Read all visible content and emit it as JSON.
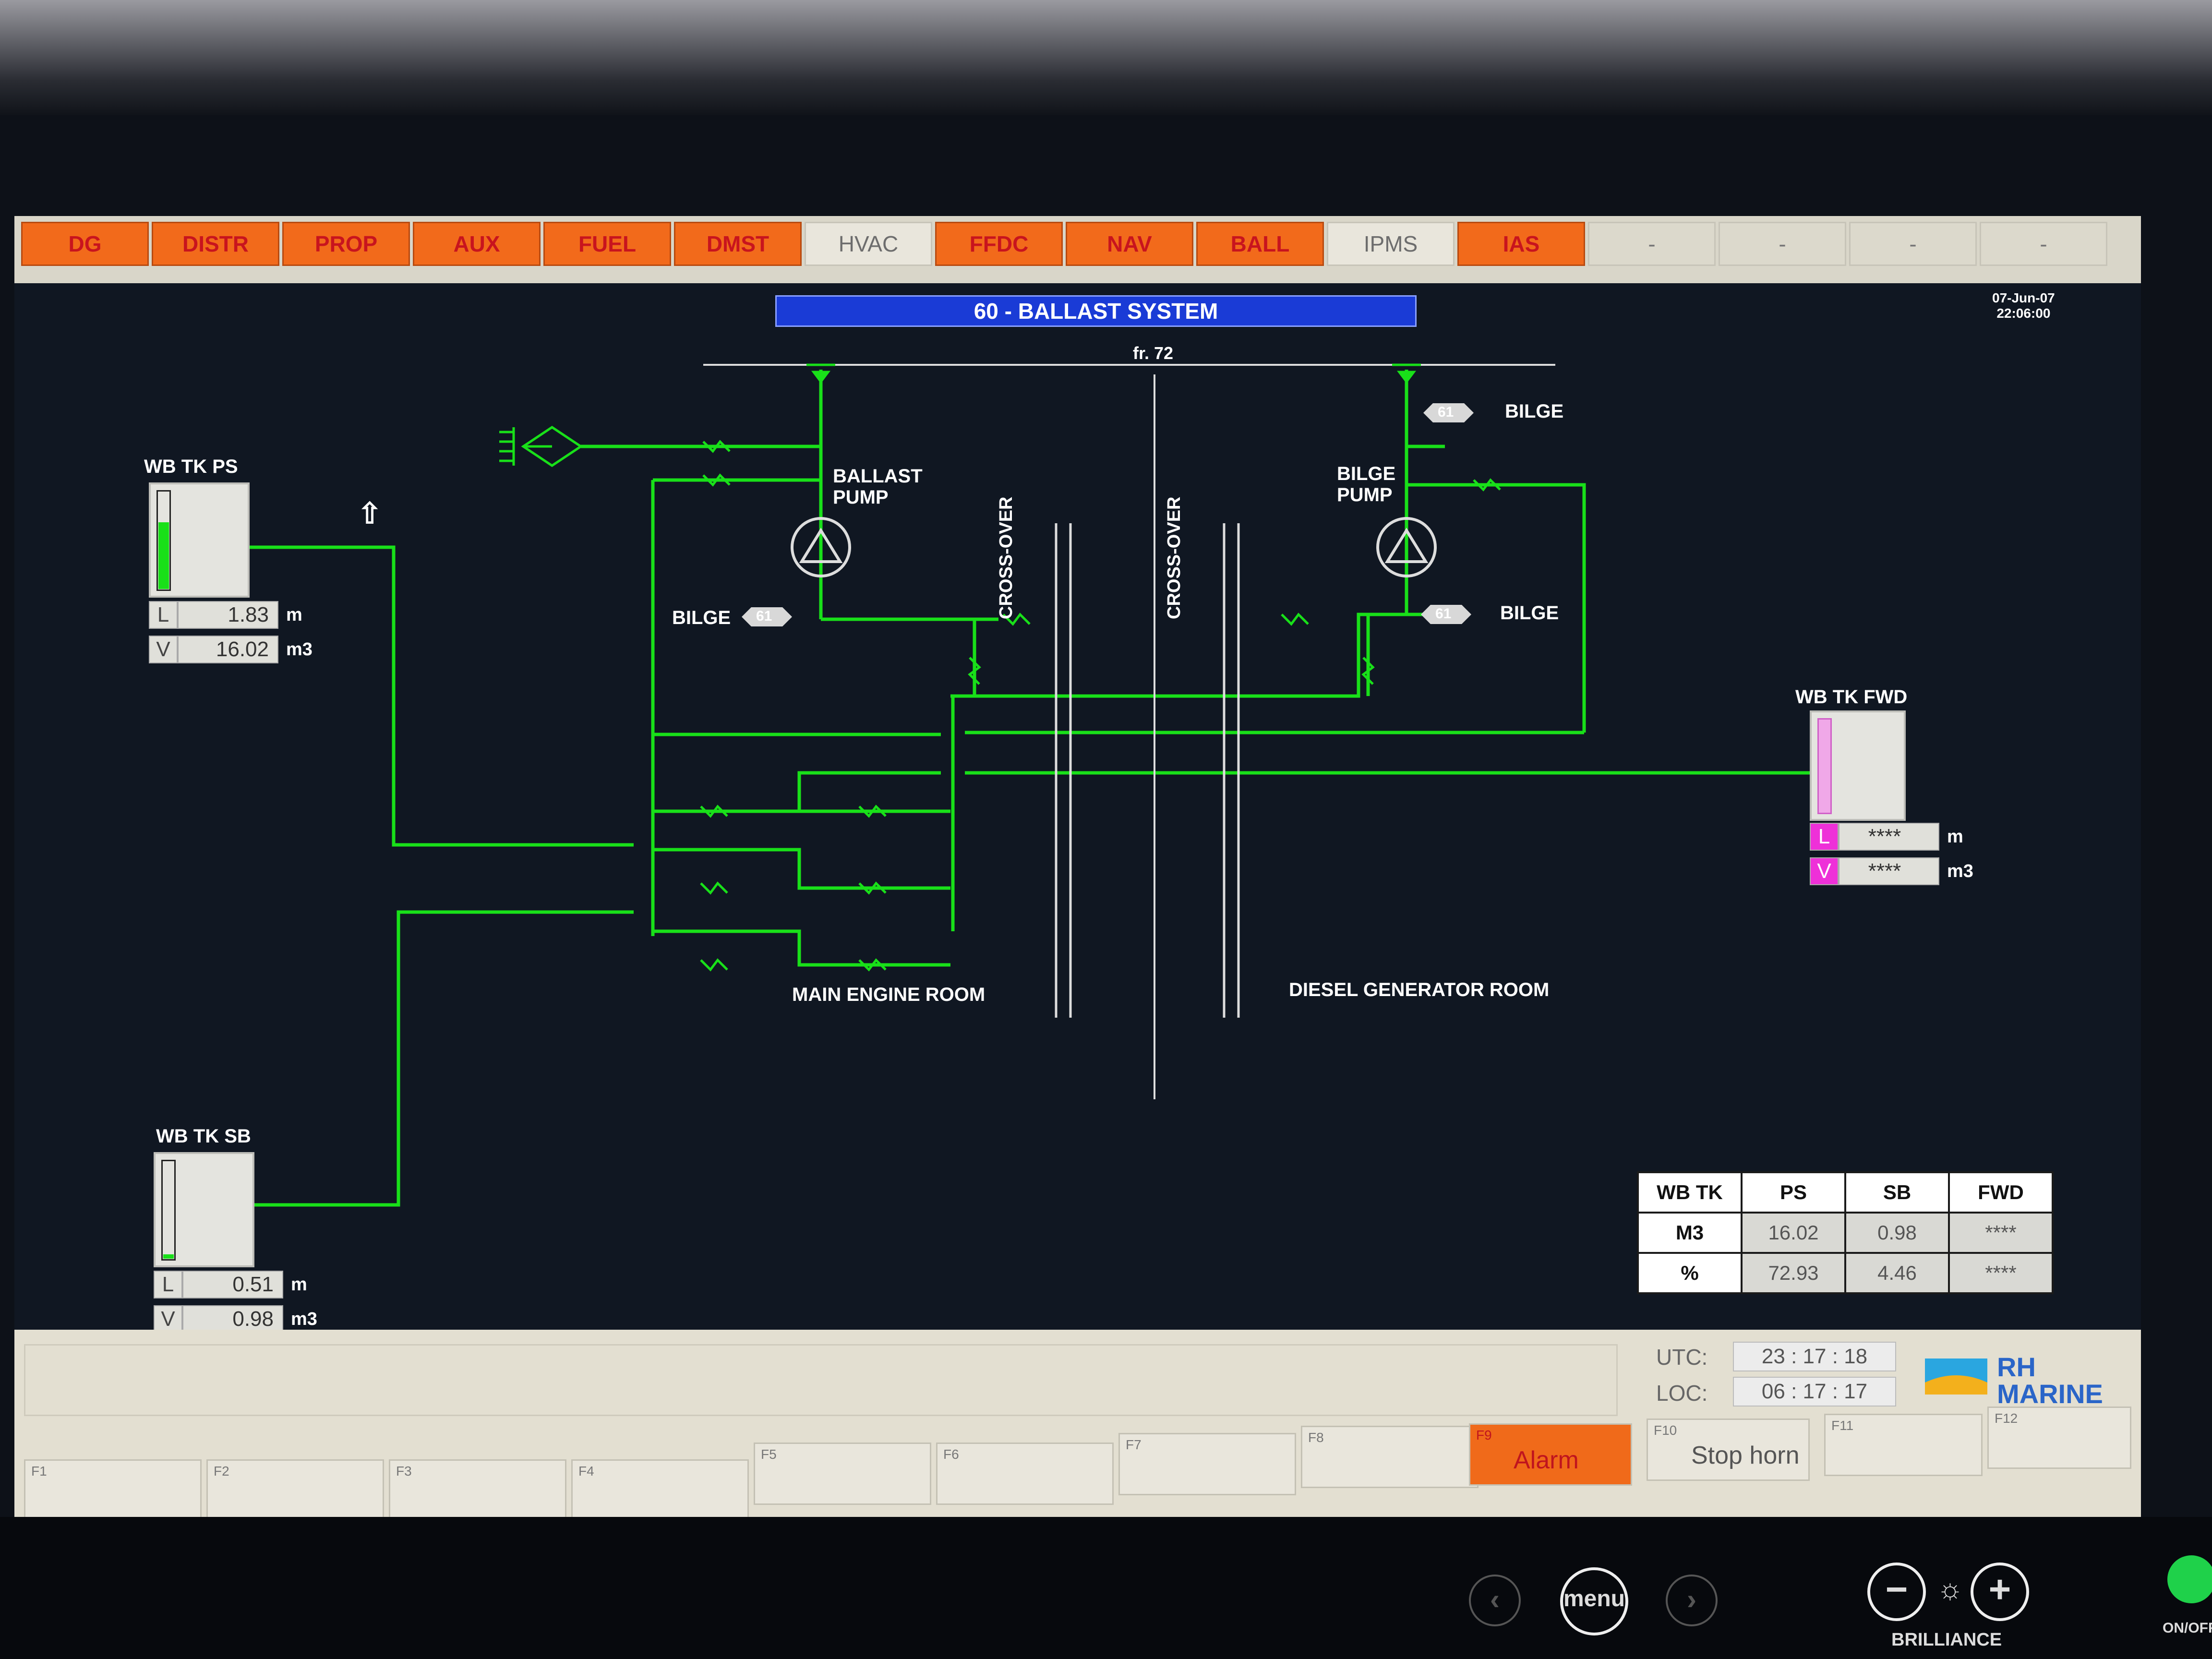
{
  "top_nav": [
    {
      "label": "DG",
      "state": "on"
    },
    {
      "label": "DISTR",
      "state": "on"
    },
    {
      "label": "PROP",
      "state": "on"
    },
    {
      "label": "AUX",
      "state": "on"
    },
    {
      "label": "FUEL",
      "state": "on"
    },
    {
      "label": "DMST",
      "state": "on"
    },
    {
      "label": "HVAC",
      "state": "off"
    },
    {
      "label": "FFDC",
      "state": "on"
    },
    {
      "label": "NAV",
      "state": "on"
    },
    {
      "label": "BALL",
      "state": "on"
    },
    {
      "label": "IPMS",
      "state": "off"
    },
    {
      "label": "IAS",
      "state": "on"
    },
    {
      "label": "-",
      "state": "blank"
    },
    {
      "label": "-",
      "state": "blank"
    },
    {
      "label": "-",
      "state": "blank"
    },
    {
      "label": "-",
      "state": "blank"
    }
  ],
  "title": "60 - BALLAST SYSTEM",
  "date": "07-Jun-07",
  "time": "22:06:00",
  "frame_label": "fr. 72",
  "labels": {
    "ballast_pump": "BALLAST\nPUMP",
    "bilge_pump": "BILGE\nPUMP",
    "bilge": "BILGE",
    "tag_61": "61",
    "crossover": "CROSS-OVER",
    "main_engine_room": "MAIN ENGINE ROOM",
    "dg_room": "DIESEL GENERATOR ROOM"
  },
  "tanks": {
    "ps": {
      "name": "WB TK PS",
      "L": "1.83",
      "V": "16.02",
      "L_unit": "m",
      "V_unit": "m3",
      "level": 0.73
    },
    "sb": {
      "name": "WB TK SB",
      "L": "0.51",
      "V": "0.98",
      "L_unit": "m",
      "V_unit": "m3",
      "level": 0.05
    },
    "fwd": {
      "name": "WB TK FWD",
      "L": "****",
      "V": "****",
      "L_unit": "m",
      "V_unit": "m3"
    }
  },
  "summary_table": {
    "headers": [
      "WB TK",
      "PS",
      "SB",
      "FWD"
    ],
    "rows": [
      {
        "label": "M3",
        "values": [
          "16.02",
          "0.98",
          "****"
        ]
      },
      {
        "label": "%",
        "values": [
          "72.93",
          "4.46",
          "****"
        ]
      }
    ]
  },
  "clock": {
    "utc_label": "UTC:",
    "utc": "23 : 17 : 18",
    "loc_label": "LOC:",
    "loc": "06 : 17 : 17"
  },
  "fkeys": [
    {
      "n": "F1",
      "t": ""
    },
    {
      "n": "F2",
      "t": ""
    },
    {
      "n": "F3",
      "t": ""
    },
    {
      "n": "F4",
      "t": ""
    },
    {
      "n": "F5",
      "t": ""
    },
    {
      "n": "F6",
      "t": ""
    },
    {
      "n": "F7",
      "t": ""
    },
    {
      "n": "F8",
      "t": ""
    },
    {
      "n": "F9",
      "t": "Alarm"
    },
    {
      "n": "F10",
      "t": "Stop horn"
    },
    {
      "n": "F11",
      "t": ""
    },
    {
      "n": "F12",
      "t": ""
    }
  ],
  "logo": {
    "line1": "RH",
    "line2": "MARINE"
  },
  "bezel": {
    "menu": "menu",
    "brilliance": "BRILLIANCE",
    "onoff": "ON/OFF"
  },
  "colors": {
    "pipe": "#19e019",
    "alarm": "#f06a1a",
    "title_bg": "#1a3bd6",
    "fwd_tag": "#ee30d8"
  }
}
